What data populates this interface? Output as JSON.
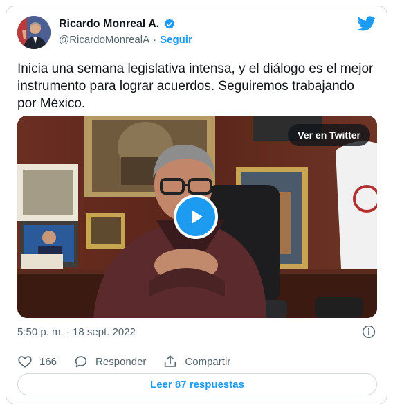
{
  "author": {
    "name": "Ricardo Monreal A.",
    "handle": "@RicardoMonrealA",
    "separator": "·",
    "follow_label": "Seguir"
  },
  "tweet": {
    "text": "Inicia una semana legislativa intensa, y el diálogo es el mejor\ninstrumento para lograr acuerdos. Seguiremos trabajando\npor México."
  },
  "media": {
    "watch_label": "Ver en Twitter",
    "play_icon": "play-icon"
  },
  "meta": {
    "timestamp": "5:50 p. m. · 18 sept. 2022"
  },
  "actions": {
    "likes_count": "166",
    "reply_label": "Responder",
    "share_label": "Compartir"
  },
  "footer": {
    "read_replies_label": "Leer 87 respuestas"
  },
  "colors": {
    "accent": "#1d9bf0",
    "text": "#0f1419",
    "secondary": "#536471",
    "border": "#cfd9de"
  }
}
